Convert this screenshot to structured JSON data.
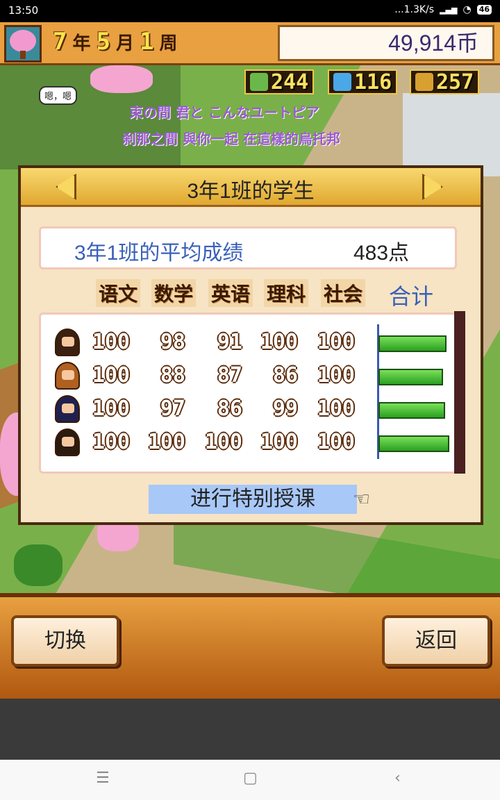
{
  "status": {
    "time": "13:50",
    "net": "...1.3K/s",
    "battery": "46"
  },
  "top": {
    "year_num": "7",
    "year_lbl": "年",
    "month_num": "5",
    "month_lbl": "月",
    "week_num": "1",
    "week_lbl": "周",
    "money": "49,914币"
  },
  "resources": [
    {
      "icon": "pencil-icon",
      "value": "244",
      "color": "#6ab84a"
    },
    {
      "icon": "flask-icon",
      "value": "116",
      "color": "#4aa8e8"
    },
    {
      "icon": "bell-icon",
      "value": "257",
      "color": "#d8a030"
    }
  ],
  "scene": {
    "bubble": "嗯，嗯",
    "line1": "束の間 君と こんなユートピア",
    "line2": "刹那之間 與你一起 在這樣的烏托邦"
  },
  "panel": {
    "title": "3年1班的学生",
    "avg_label": "3年1班的平均成绩",
    "avg_value": "483点",
    "subjects": [
      "语文",
      "数学",
      "英语",
      "理科",
      "社会"
    ],
    "total_label": "合计",
    "special_button": "进行特别授课"
  },
  "students": [
    {
      "scores": [
        "100",
        "98",
        "91",
        "100",
        "100"
      ],
      "total_fraction": 0.96,
      "hair": "#3a2010"
    },
    {
      "scores": [
        "100",
        "88",
        "87",
        "86",
        "100"
      ],
      "total_fraction": 0.91,
      "hair": "#b06020"
    },
    {
      "scores": [
        "100",
        "97",
        "86",
        "99",
        "100"
      ],
      "total_fraction": 0.94,
      "hair": "#202050"
    },
    {
      "scores": [
        "100",
        "100",
        "100",
        "100",
        "100"
      ],
      "total_fraction": 1.0,
      "hair": "#2a1a10"
    }
  ],
  "bottom": {
    "switch": "切换",
    "back": "返回"
  },
  "nav": {
    "menu": "☰",
    "home": "▢",
    "back": "‹"
  }
}
